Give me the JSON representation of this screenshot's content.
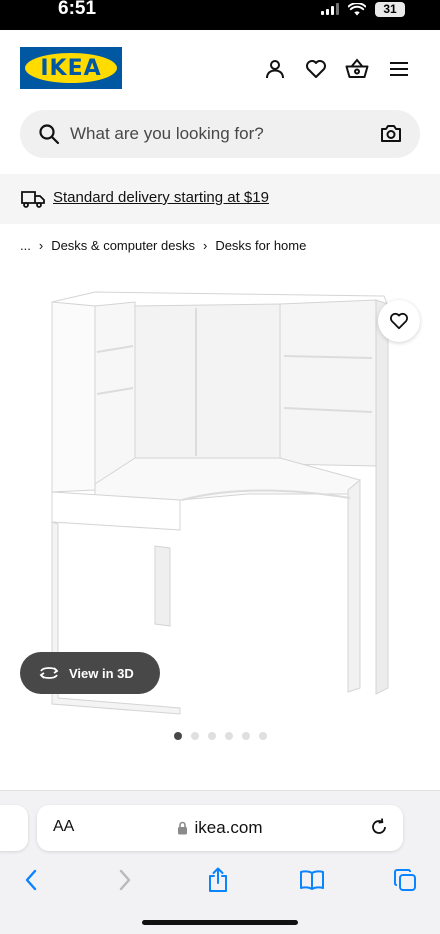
{
  "status_bar": {
    "time": "6:51",
    "battery": "31"
  },
  "header": {
    "logo_text": "IKEA"
  },
  "search": {
    "placeholder": "What are you looking for?"
  },
  "delivery": {
    "text": "Standard delivery starting at $19"
  },
  "breadcrumb": {
    "ellipsis": "...",
    "items": [
      "Desks & computer desks",
      "Desks for home"
    ]
  },
  "product": {
    "view_3d_label": "View in 3D",
    "carousel_total": 6,
    "carousel_active": 0
  },
  "safari": {
    "aa_label": "AA",
    "url": "ikea.com"
  },
  "colors": {
    "ikea_blue": "#0058a3",
    "ikea_yellow": "#ffdb00",
    "button_dark": "#484848",
    "ios_blue": "#0a84ff"
  },
  "icons": [
    "profile-icon",
    "heart-icon",
    "basket-icon",
    "menu-icon",
    "search-icon",
    "camera-icon",
    "truck-icon",
    "rotate-3d-icon",
    "lock-icon",
    "reload-icon",
    "back-icon",
    "forward-icon",
    "share-icon",
    "bookmarks-icon",
    "tabs-icon"
  ]
}
